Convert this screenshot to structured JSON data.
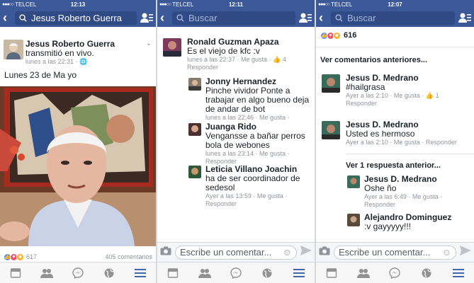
{
  "status": {
    "carrier": "TELCEL",
    "time1": "12:13",
    "time2": "12:11",
    "time3": "12:07"
  },
  "panel1": {
    "search_text": "Jesus Roberto Guerra",
    "author": "Jesus Roberto Guerra",
    "action": "transmitió en vivo.",
    "timestamp": "lunes a las 22:31",
    "post_text": "Lunes 23 de Ma yo",
    "reaction_count": "617",
    "comment_count": "405 comentarios"
  },
  "panel2": {
    "search_placeholder": "Buscar",
    "comments": [
      {
        "name": "Ronald Guzman Apaza",
        "text": "Es el viejo de kfc :v",
        "meta": "lunes a las 22:37 · Me gusta ·",
        "likes": "4",
        "reply": "Responder"
      },
      {
        "name": "Jonny Hernandez",
        "text": "Pinche vividor Ponte a trabajar en algo bueno deja de andar de bot",
        "meta": "lunes a las 22:46 · Me gusta ·"
      },
      {
        "name": "Juanga Rido",
        "text": "Vengansse a bañar perros bola de webones",
        "meta": "lunes a las 23:14 · Me gusta ·",
        "reply": "Responder"
      },
      {
        "name": "Leticia Villano Joachin",
        "text": "ha de ser coordinador de sedesol",
        "meta": "Ayer a las 13:59 · Me gusta ·",
        "reply": "Responder"
      }
    ],
    "comment_placeholder": "Escribe un comentar..."
  },
  "panel3": {
    "search_placeholder": "Buscar",
    "reaction_count": "616",
    "see_previous": "Ver comentarios anteriores...",
    "comments": [
      {
        "name": "Jesus D. Medrano",
        "text": "#hailgrasa",
        "meta": "Ayer a las 2:10 · Me gusta ·",
        "likes": "1",
        "reply": "Responder"
      },
      {
        "name": "Jesus D. Medrano",
        "text": "Usted es hermoso",
        "meta": "Ayer a las 2:10 · Me gusta · Responder"
      }
    ],
    "see_reply": "Ver 1 respuesta anterior...",
    "replies": [
      {
        "name": "Jesus D. Medrano",
        "text": "Oshe ño",
        "meta": "Ayer a las 6:49 · Me gusta ·",
        "reply": "Responder"
      },
      {
        "name": "Alejandro Dominguez",
        "text": ":v gayyyyy!!!"
      }
    ],
    "comment_placeholder": "Escribe un comentar..."
  },
  "colors": {
    "brand": "#3b5998",
    "tab_active": "#4267b2"
  }
}
